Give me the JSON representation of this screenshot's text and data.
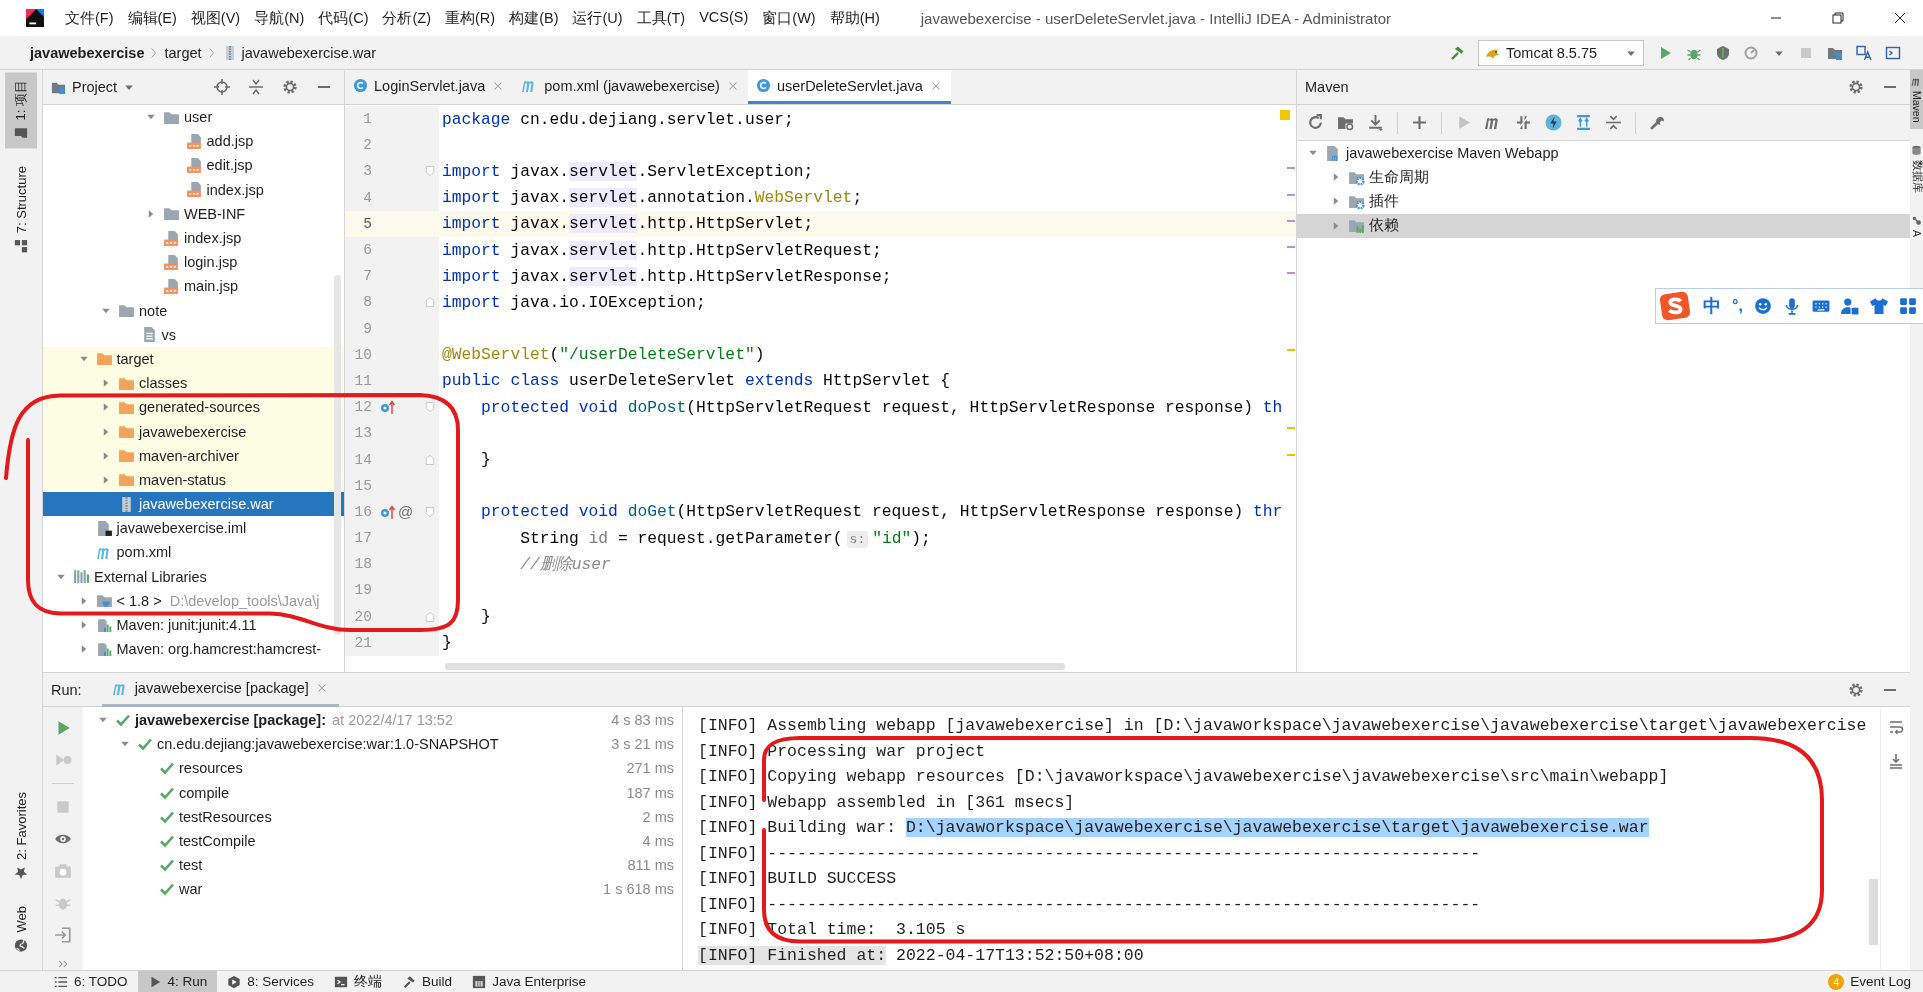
{
  "window": {
    "title": "javawebexercise - userDeleteServlet.java - IntelliJ IDEA - Administrator"
  },
  "menu": [
    "文件(F)",
    "编辑(E)",
    "视图(V)",
    "导航(N)",
    "代码(C)",
    "分析(Z)",
    "重构(R)",
    "构建(B)",
    "运行(U)",
    "工具(T)",
    "VCS(S)",
    "窗口(W)",
    "帮助(H)"
  ],
  "breadcrumbs": [
    {
      "label": "javawebexercise",
      "kind": "module"
    },
    {
      "label": "target",
      "kind": "folder"
    },
    {
      "label": "javawebexercise.war",
      "kind": "war"
    }
  ],
  "run_config": {
    "label": "Tomcat 8.5.75"
  },
  "left_stripe": {
    "top": [
      {
        "label": "1: 项目",
        "selected": true
      },
      {
        "label": "7: Structure",
        "selected": false
      }
    ],
    "bottom": [
      {
        "label": "2: Favorites",
        "selected": false
      },
      {
        "label": "Web",
        "selected": false
      }
    ]
  },
  "right_stripe": [
    {
      "label": "Maven",
      "selected": true
    },
    {
      "label": "数据库",
      "selected": false
    },
    {
      "label": "A",
      "selected": false
    }
  ],
  "project": {
    "title": "Project",
    "tree": [
      {
        "children": [
          {
            "children": [
              {
                "children": [
                  {
                    "children": [
                      {
                        "label": "user",
                        "kind": "folder",
                        "expanded": true,
                        "selected": false,
                        "excluded": false,
                        "children": [
                          {
                            "label": "add.jsp",
                            "kind": "jsp",
                            "selected": false,
                            "excluded": false
                          },
                          {
                            "label": "edit.jsp",
                            "kind": "jsp",
                            "selected": false,
                            "excluded": false
                          },
                          {
                            "label": "index.jsp",
                            "kind": "jsp",
                            "selected": false,
                            "excluded": false
                          }
                        ]
                      },
                      {
                        "label": "WEB-INF",
                        "kind": "folder",
                        "expanded": false,
                        "selected": false,
                        "excluded": false
                      },
                      {
                        "label": "index.jsp",
                        "kind": "jsp",
                        "selected": false,
                        "excluded": false
                      },
                      {
                        "label": "login.jsp",
                        "kind": "jsp",
                        "selected": false,
                        "excluded": false
                      },
                      {
                        "label": "main.jsp",
                        "kind": "jsp",
                        "selected": false,
                        "excluded": false
                      }
                    ]
                  }
                ]
              },
              {
                "label": "note",
                "kind": "folder",
                "expanded": true,
                "selected": false,
                "excluded": false,
                "children": [
                  {
                    "label": "vs",
                    "kind": "text",
                    "selected": false,
                    "excluded": false
                  }
                ]
              }
            ]
          },
          {
            "label": "target",
            "kind": "folder",
            "expanded": true,
            "selected": false,
            "excluded": true,
            "children": [
              {
                "label": "classes",
                "kind": "folder",
                "expanded": false,
                "selected": false,
                "excluded": true
              },
              {
                "label": "generated-sources",
                "kind": "folder",
                "expanded": false,
                "selected": false,
                "excluded": true
              },
              {
                "label": "javawebexercise",
                "kind": "folder",
                "expanded": false,
                "selected": false,
                "excluded": true
              },
              {
                "label": "maven-archiver",
                "kind": "folder",
                "expanded": false,
                "selected": false,
                "excluded": true
              },
              {
                "label": "maven-status",
                "kind": "folder",
                "expanded": false,
                "selected": false,
                "excluded": true
              },
              {
                "label": "javawebexercise.war",
                "kind": "war",
                "selected": true,
                "excluded": true
              }
            ]
          },
          {
            "label": "javawebexercise.iml",
            "kind": "iml",
            "selected": false,
            "excluded": false
          },
          {
            "label": "pom.xml",
            "kind": "pom",
            "selected": false,
            "excluded": false
          }
        ]
      },
      {
        "label": "External Libraries",
        "kind": "libraries",
        "expanded": true,
        "selected": false,
        "excluded": false,
        "children": [
          {
            "label": "< 1.8 >",
            "detail": "D:\\develop_tools\\Java\\j",
            "kind": "jdk",
            "expanded": false,
            "selected": false,
            "excluded": false
          },
          {
            "label": "Maven: junit:junit:4.11",
            "kind": "library",
            "expanded": false,
            "selected": false,
            "excluded": false
          },
          {
            "label": "Maven: org.hamcrest:hamcrest-",
            "kind": "library",
            "expanded": false,
            "selected": false,
            "excluded": false
          }
        ]
      }
    ]
  },
  "editor": {
    "tabs": [
      {
        "label": "LoginServlet.java",
        "kind": "class",
        "selected": false
      },
      {
        "label": "pom.xml (javawebexercise)",
        "kind": "pom",
        "selected": false
      },
      {
        "label": "userDeleteServlet.java",
        "kind": "class",
        "selected": true
      }
    ],
    "lines": [
      {
        "number": "1",
        "current": false,
        "override": false,
        "fold_start": false,
        "fold_end": false,
        "tokens": [
          {
            "t": "package",
            "kind": "kw"
          },
          {
            "t": " cn.edu.dejiang.servlet.user;",
            "kind": "plain"
          }
        ]
      },
      {
        "number": "2",
        "current": false,
        "override": false,
        "fold_start": false,
        "fold_end": false
      },
      {
        "number": "3",
        "current": false,
        "override": false,
        "fold_start": true,
        "fold_end": false,
        "tokens": [
          {
            "t": "import",
            "kind": "kw"
          },
          {
            "t": " javax.",
            "kind": "plain"
          },
          {
            "t": "servlet",
            "kind": "hl"
          },
          {
            "t": ".ServletException;",
            "kind": "plain"
          }
        ]
      },
      {
        "number": "4",
        "current": false,
        "override": false,
        "fold_start": false,
        "fold_end": false,
        "tokens": [
          {
            "t": "import",
            "kind": "kw"
          },
          {
            "t": " javax.",
            "kind": "plain"
          },
          {
            "t": "servlet",
            "kind": "hl"
          },
          {
            "t": ".annotation.",
            "kind": "plain"
          },
          {
            "t": "WebServlet",
            "kind": "ann"
          },
          {
            "t": ";",
            "kind": "plain"
          }
        ]
      },
      {
        "number": "5",
        "current": true,
        "override": false,
        "fold_start": false,
        "fold_end": false,
        "tokens": [
          {
            "t": "import",
            "kind": "kw"
          },
          {
            "t": " javax.",
            "kind": "plain"
          },
          {
            "t": "servlet",
            "kind": "hl"
          },
          {
            "t": ".http.HttpServlet;",
            "kind": "plain"
          }
        ]
      },
      {
        "number": "6",
        "current": false,
        "override": false,
        "fold_start": false,
        "fold_end": false,
        "tokens": [
          {
            "t": "import",
            "kind": "kw"
          },
          {
            "t": " javax.",
            "kind": "plain"
          },
          {
            "t": "servlet",
            "kind": "hl"
          },
          {
            "t": ".http.HttpServletRequest;",
            "kind": "plain"
          }
        ]
      },
      {
        "number": "7",
        "current": false,
        "override": false,
        "fold_start": false,
        "fold_end": false,
        "tokens": [
          {
            "t": "import",
            "kind": "kw"
          },
          {
            "t": " javax.",
            "kind": "plain"
          },
          {
            "t": "servlet",
            "kind": "hl"
          },
          {
            "t": ".http.HttpServletResponse;",
            "kind": "plain"
          }
        ]
      },
      {
        "number": "8",
        "current": false,
        "override": false,
        "fold_start": false,
        "fold_end": true,
        "tokens": [
          {
            "t": "import",
            "kind": "kw"
          },
          {
            "t": " java.io.IOException;",
            "kind": "plain"
          }
        ]
      },
      {
        "number": "9",
        "current": false,
        "override": false,
        "fold_start": false,
        "fold_end": false
      },
      {
        "number": "10",
        "current": false,
        "override": false,
        "fold_start": false,
        "fold_end": false,
        "tokens": [
          {
            "t": "@WebServlet",
            "kind": "ann"
          },
          {
            "t": "(",
            "kind": "plain"
          },
          {
            "t": "\"/userDeleteServlet\"",
            "kind": "str"
          },
          {
            "t": ")",
            "kind": "plain"
          }
        ]
      },
      {
        "number": "11",
        "current": false,
        "override": false,
        "fold_start": false,
        "fold_end": false,
        "tokens": [
          {
            "t": "public class",
            "kind": "kw"
          },
          {
            "t": " userDeleteServlet ",
            "kind": "plain"
          },
          {
            "t": "extends",
            "kind": "kw"
          },
          {
            "t": " HttpServlet {",
            "kind": "plain"
          }
        ]
      },
      {
        "number": "12",
        "current": false,
        "override": true,
        "fold_start": true,
        "fold_end": false,
        "tokens": [
          {
            "t": "    protected void",
            "kind": "kw"
          },
          {
            "t": " doPost",
            "kind": "method"
          },
          {
            "t": "(HttpServletRequest request, HttpServletResponse response) ",
            "kind": "plain"
          },
          {
            "t": "th",
            "kind": "kw"
          }
        ]
      },
      {
        "number": "13",
        "current": false,
        "override": false,
        "fold_start": false,
        "fold_end": false
      },
      {
        "number": "14",
        "current": false,
        "override": false,
        "fold_start": false,
        "fold_end": true,
        "tokens": [
          {
            "t": "    }",
            "kind": "plain"
          }
        ]
      },
      {
        "number": "15",
        "current": false,
        "override": false,
        "fold_start": false,
        "fold_end": false
      },
      {
        "number": "16",
        "current": false,
        "override": true,
        "mark_text": "@",
        "fold_start": true,
        "fold_end": false,
        "tokens": [
          {
            "t": "    protected void",
            "kind": "kw"
          },
          {
            "t": " doGet",
            "kind": "method"
          },
          {
            "t": "(HttpServletRequest request, HttpServletResponse response) ",
            "kind": "plain"
          },
          {
            "t": "thr",
            "kind": "kw"
          }
        ]
      },
      {
        "number": "17",
        "current": false,
        "override": false,
        "fold_start": false,
        "fold_end": false,
        "tokens": [
          {
            "t": "        String ",
            "kind": "plain"
          },
          {
            "t": "id",
            "kind": "unused"
          },
          {
            "t": " = request.getParameter(",
            "kind": "plain"
          },
          {
            "t": "s:",
            "kind": "hint"
          },
          {
            "t": "\"id\"",
            "kind": "str"
          },
          {
            "t": ");",
            "kind": "plain"
          }
        ]
      },
      {
        "number": "18",
        "current": false,
        "override": false,
        "fold_start": false,
        "fold_end": false,
        "tokens": [
          {
            "t": "        //删除user",
            "kind": "comment"
          }
        ]
      },
      {
        "number": "19",
        "current": false,
        "override": false,
        "fold_start": false,
        "fold_end": false
      },
      {
        "number": "20",
        "current": false,
        "override": false,
        "fold_start": false,
        "fold_end": true,
        "tokens": [
          {
            "t": "    }",
            "kind": "plain"
          }
        ]
      },
      {
        "number": "21",
        "current": false,
        "override": false,
        "fold_start": false,
        "fold_end": false,
        "tokens": [
          {
            "t": "}",
            "kind": "plain"
          }
        ]
      }
    ]
  },
  "maven": {
    "title": "Maven",
    "tree": [
      {
        "label": "javawebexercise Maven Webapp",
        "kind": "project",
        "expanded": true,
        "selected": false,
        "children": [
          {
            "label": "生命周期",
            "kind": "lifecycle",
            "expanded": false,
            "selected": false
          },
          {
            "label": "插件",
            "kind": "plugins",
            "expanded": false,
            "selected": false
          },
          {
            "label": "依赖",
            "kind": "dependencies",
            "expanded": false,
            "selected": true
          }
        ]
      }
    ]
  },
  "ime": {
    "mode": "中",
    "punctuation": "°,"
  },
  "run": {
    "label": "Run:",
    "tab": {
      "label": "javawebexercise [package]",
      "selected": true
    },
    "tree": [
      {
        "label": "javawebexercise [package]:",
        "detail": "at 2022/4/17 13:52",
        "time": "4 s 83 ms",
        "passed": true,
        "expanded": true,
        "selected": false,
        "children": [
          {
            "label": "cn.edu.dejiang:javawebexercise:war:1.0-SNAPSHOT",
            "time": "3 s 21 ms",
            "passed": true,
            "expanded": true,
            "selected": false,
            "children": [
              {
                "label": "resources",
                "time": "271 ms",
                "passed": true,
                "selected": false
              },
              {
                "label": "compile",
                "time": "187 ms",
                "passed": true,
                "selected": false
              },
              {
                "label": "testResources",
                "time": "2 ms",
                "passed": true,
                "selected": false
              },
              {
                "label": "testCompile",
                "time": "4 ms",
                "passed": true,
                "selected": false
              },
              {
                "label": "test",
                "time": "811 ms",
                "passed": true,
                "selected": false
              },
              {
                "label": "war",
                "time": "1 s 618 ms",
                "passed": true,
                "selected": false
              }
            ]
          }
        ]
      }
    ],
    "console": [
      {
        "parts": [
          {
            "t": "[INFO] Assembling webapp [javawebexercise] in [D:\\javaworkspace\\javawebexercise\\javawebexercise\\target\\javawebexercise",
            "kind": "plain"
          }
        ]
      },
      {
        "parts": [
          {
            "t": "[INFO] Processing war project",
            "kind": "plain"
          }
        ]
      },
      {
        "parts": [
          {
            "t": "[INFO] Copying webapp resources [D:\\javaworkspace\\javawebexercise\\javawebexercise\\src\\main\\webapp]",
            "kind": "plain"
          }
        ]
      },
      {
        "parts": [
          {
            "t": "[INFO] Webapp assembled in [361 msecs]",
            "kind": "plain"
          }
        ]
      },
      {
        "parts": [
          {
            "t": "[INFO] Building war: ",
            "kind": "plain"
          },
          {
            "t": "D:\\javaworkspace\\javawebexercise\\javawebexercise\\target\\javawebexercise.war",
            "kind": "selected"
          }
        ]
      },
      {
        "parts": [
          {
            "t": "[INFO] ------------------------------------------------------------------------",
            "kind": "plain"
          }
        ]
      },
      {
        "parts": [
          {
            "t": "[INFO] BUILD SUCCESS",
            "kind": "plain"
          }
        ]
      },
      {
        "parts": [
          {
            "t": "[INFO] ------------------------------------------------------------------------",
            "kind": "plain"
          }
        ]
      },
      {
        "parts": [
          {
            "t": "[INFO] Total time:  3.105 s",
            "kind": "plain"
          }
        ]
      },
      {
        "parts": [
          {
            "t": "[INFO] Finished at:",
            "kind": "marked"
          },
          {
            "t": " 2022-04-17T13:52:50+08:00",
            "kind": "plain"
          }
        ]
      }
    ]
  },
  "tool_tabs": [
    {
      "label": "6: TODO",
      "kind": "todo",
      "selected": false
    },
    {
      "label": "4: Run",
      "kind": "run",
      "selected": true
    },
    {
      "label": "8: Services",
      "kind": "services",
      "selected": false
    },
    {
      "label": "终端",
      "kind": "terminal",
      "selected": false
    },
    {
      "label": "Build",
      "kind": "build",
      "selected": false
    },
    {
      "label": "Java Enterprise",
      "kind": "enterprise",
      "selected": false
    }
  ],
  "event_log": {
    "label": "Event Log",
    "count": "4"
  }
}
